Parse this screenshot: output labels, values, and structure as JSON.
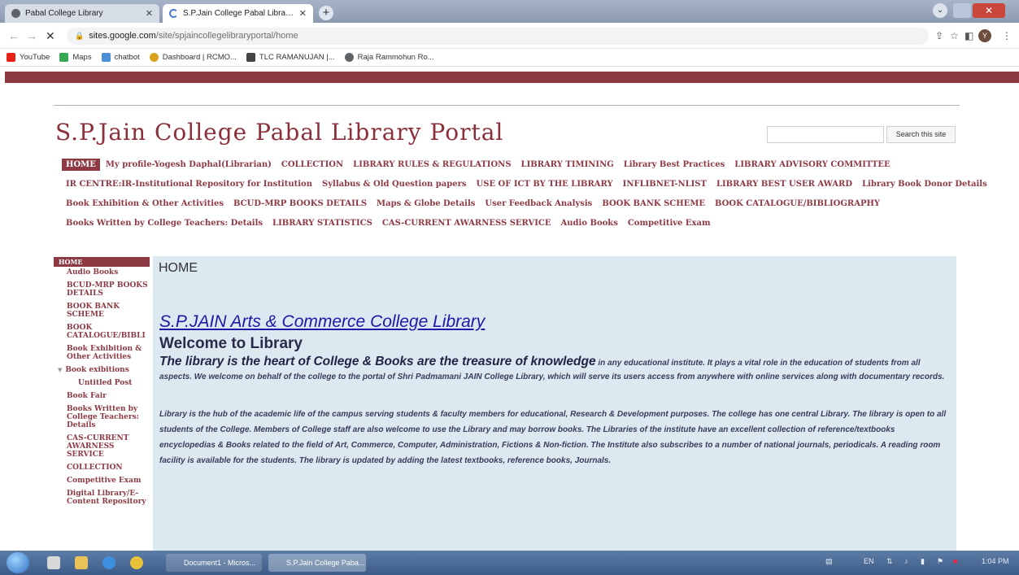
{
  "browser": {
    "tabs": [
      {
        "title": "Pabal College Library",
        "active": false
      },
      {
        "title": "S.P.Jain College Pabal Library Po",
        "active": true
      }
    ],
    "url": {
      "host": "sites.google.com",
      "path": "/site/spjaincollegelibraryportal/home"
    },
    "bookmarks": [
      "YouTube",
      "Maps",
      "chatbot",
      "Dashboard | RCMO...",
      "TLC RAMANUJAN |...",
      "Raja Rammohun Ro..."
    ],
    "profile_initial": "Y"
  },
  "site": {
    "title": "S.P.Jain College Pabal Library Portal",
    "search_button": "Search this site",
    "nav_rows": [
      [
        "HOME",
        "My profile-Yogesh Daphal(Librarian)",
        "COLLECTION",
        "LIBRARY RULES & REGULATIONS",
        "LIBRARY TIMINING",
        "Library Best Practices",
        "LIBRARY ADVISORY COMMITTEE"
      ],
      [
        "IR CENTRE:IR-Institutional Repository for Institution",
        "Syllabus & Old Question papers",
        "USE OF ICT BY THE LIBRARY",
        "INFLIBNET-NLIST",
        "LIBRARY BEST USER AWARD",
        "Library Book Donor Details"
      ],
      [
        "Book Exhibition & Other Activities",
        "BCUD-MRP BOOKS DETAILS",
        "Maps & Globe Details",
        "User Feedback Analysis",
        "BOOK BANK SCHEME",
        "BOOK CATALOGUE/BIBLIOGRAPHY"
      ],
      [
        "Books Written by College Teachers: Details",
        "LIBRARY STATISTICS",
        "CAS-CURRENT AWARNESS SERVICE",
        "Audio Books",
        "Competitive Exam"
      ]
    ],
    "sidebar": {
      "header": "HOME",
      "items": [
        {
          "label": "Audio Books"
        },
        {
          "label": "BCUD-MRP BOOKS DETAILS"
        },
        {
          "label": "BOOK BANK SCHEME"
        },
        {
          "label": "BOOK CATALOGUE/BIBLI"
        },
        {
          "label": "Book Exhibition & Other Activities"
        },
        {
          "label": "Book exibitions",
          "expanded": true
        },
        {
          "label": "Untitled Post",
          "sub": true
        },
        {
          "label": "Book Fair"
        },
        {
          "label": "Books Written by College Teachers: Details"
        },
        {
          "label": "CAS-CURRENT AWARNESS SERVICE"
        },
        {
          "label": "COLLECTION"
        },
        {
          "label": "Competitive Exam"
        },
        {
          "label": "Digital Library/E-Content Repository"
        }
      ]
    },
    "content": {
      "page_heading": "HOME",
      "college_title": "S.P.JAIN Arts & Commerce College Library",
      "welcome": "Welcome to  Library",
      "para1_lead": "The library is the heart of College & Books are the treasure of knowledge",
      "para1_rest": " in any educational institute. It plays a vital role in the education of students from all aspects. We welcome on behalf of the college to the portal of Shri Padmamani JAIN College Library, which will serve its users access from anywhere with online services along with documentary records.",
      "para2": "Library is the hub of the academic life of the campus serving students & faculty members for educational, Research & Development purposes. The college has one central Library. The library is open to all students of the College.  Members of College staff are also welcome to use the Library and may borrow books.  The Libraries of the institute have an excellent collection of reference/textbooks encyclopedias & Books related to the field of Art, Commerce, Computer, Administration, Fictions & Non-fiction. The Institute also subscribes to a number of national journals, periodicals. A reading room facility is available for the students. The library is updated by adding the latest textbooks, reference books, Journals."
    }
  },
  "taskbar": {
    "buttons": [
      "Document1 - Micros...",
      "S.P.Jain College Paba..."
    ],
    "language": "EN",
    "time": "1:04 PM"
  },
  "colors": {
    "brand": "#8e3a44",
    "content_bg": "#dde9f1",
    "link": "#1a1aa6"
  }
}
